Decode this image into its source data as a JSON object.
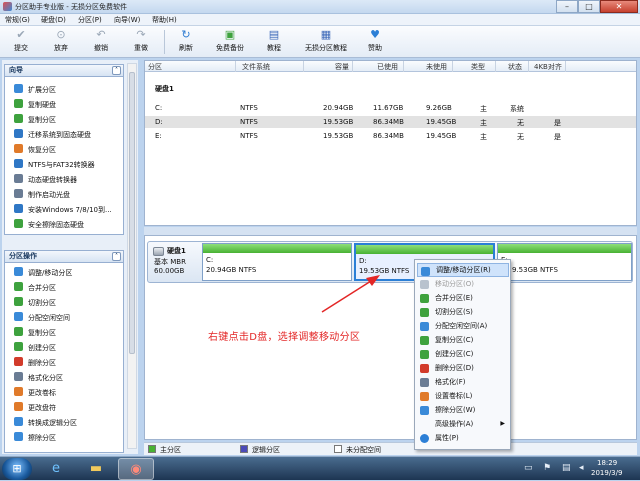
{
  "window": {
    "title": "分区助手专业版 - 无损分区免费软件",
    "minimize": "–",
    "maximize": "□",
    "close": "✕"
  },
  "menu": [
    "常规(G)",
    "硬盘(D)",
    "分区(P)",
    "向导(W)",
    "帮助(H)"
  ],
  "toolbar": [
    {
      "label": "提交",
      "icon": "✔",
      "color": "#9aa7b6"
    },
    {
      "label": "放弃",
      "icon": "⊙",
      "color": "#9aa7b6"
    },
    {
      "label": "撤销",
      "icon": "↶",
      "color": "#9aa7b6"
    },
    {
      "label": "重做",
      "icon": "↷",
      "color": "#9aa7b6"
    },
    {
      "label": "刷新",
      "icon": "↻",
      "color": "#2e7bd1"
    },
    {
      "label": "免费备份",
      "icon": "▣",
      "color": "#3ea23e"
    },
    {
      "label": "教程",
      "icon": "▤",
      "color": "#3a67b8"
    },
    {
      "label": "无损分区教程",
      "icon": "▦",
      "color": "#3a67b8"
    },
    {
      "label": "赞助",
      "icon": "♥",
      "color": "#2c7fd6"
    }
  ],
  "wizard": {
    "title": "向导",
    "items": [
      {
        "label": "扩展分区",
        "color": "#3a8ad8"
      },
      {
        "label": "复制硬盘",
        "color": "#3ea23e"
      },
      {
        "label": "复制分区",
        "color": "#3ea23e"
      },
      {
        "label": "迁移系统到固态硬盘",
        "color": "#2f77c5"
      },
      {
        "label": "恢复分区",
        "color": "#e07a2a"
      },
      {
        "label": "NTFS与FAT32转换器",
        "color": "#2f77c5"
      },
      {
        "label": "动态硬盘转换器",
        "color": "#6a7c94"
      },
      {
        "label": "制作启动光盘",
        "color": "#6a7c94"
      },
      {
        "label": "安装Windows 7/8/10到...",
        "color": "#2f77c5"
      },
      {
        "label": "安全擦除固态硬盘",
        "color": "#3ea23e"
      }
    ]
  },
  "ops": {
    "title": "分区操作",
    "items": [
      {
        "label": "调整/移动分区",
        "color": "#3a8ad8"
      },
      {
        "label": "合并分区",
        "color": "#3ea23e"
      },
      {
        "label": "切割分区",
        "color": "#3ea23e"
      },
      {
        "label": "分配空闲空间",
        "color": "#3a8ad8"
      },
      {
        "label": "复制分区",
        "color": "#3ea23e"
      },
      {
        "label": "创建分区",
        "color": "#3ea23e"
      },
      {
        "label": "删除分区",
        "color": "#d23b2b"
      },
      {
        "label": "格式化分区",
        "color": "#6a7c94"
      },
      {
        "label": "更改卷标",
        "color": "#e07a2a"
      },
      {
        "label": "更改盘符",
        "color": "#e07a2a"
      },
      {
        "label": "转换成逻辑分区",
        "color": "#3a8ad8"
      },
      {
        "label": "擦除分区",
        "color": "#3a8ad8"
      }
    ]
  },
  "table": {
    "headers": [
      "分区",
      "文件系统",
      "容量",
      "已使用",
      "未使用",
      "类型",
      "状态",
      "4KB对齐"
    ],
    "disk_label": "硬盘1",
    "rows": [
      {
        "part": "C:",
        "fs": "NTFS",
        "cap": "20.94GB",
        "used": "11.67GB",
        "free": "9.26GB",
        "type": "主",
        "status": "系统",
        "align": ""
      },
      {
        "part": "D:",
        "fs": "NTFS",
        "cap": "19.53GB",
        "used": "86.34MB",
        "free": "19.45GB",
        "type": "主",
        "status": "无",
        "align": "是"
      },
      {
        "part": "E:",
        "fs": "NTFS",
        "cap": "19.53GB",
        "used": "86.34MB",
        "free": "19.45GB",
        "type": "主",
        "status": "无",
        "align": "是"
      }
    ]
  },
  "disk_map": {
    "name": "硬盘1",
    "type": "基本 MBR",
    "size": "60.00GB",
    "partitions": [
      {
        "name": "C:",
        "info": "20.94GB NTFS"
      },
      {
        "name": "D:",
        "info": "19.53GB NTFS"
      },
      {
        "name": "E:",
        "info": "9.53GB NTFS"
      }
    ]
  },
  "context_menu": [
    {
      "label": "调整/移动分区(R)",
      "color": "#3a8ad8"
    },
    {
      "label": "移动分区(O)",
      "color": "#9aa7b6"
    },
    {
      "label": "合并分区(E)",
      "color": "#3ea23e"
    },
    {
      "label": "切割分区(S)",
      "color": "#3ea23e"
    },
    {
      "label": "分配空闲空间(A)",
      "color": "#3a8ad8"
    },
    {
      "label": "复制分区(C)",
      "color": "#3ea23e"
    },
    {
      "label": "创建分区(C)",
      "color": "#3ea23e"
    },
    {
      "label": "删除分区(D)",
      "color": "#d23b2b"
    },
    {
      "label": "格式化(F)",
      "color": "#6a7c94"
    },
    {
      "label": "设置卷标(L)",
      "color": "#e07a2a"
    },
    {
      "label": "擦除分区(W)",
      "color": "#3a8ad8"
    },
    {
      "label": "高级操作(A)",
      "arrow": "▶"
    },
    {
      "label": "属性(P)",
      "color": "#2c7fd6"
    }
  ],
  "annotation": "右键点击D盘，选择调整移动分区",
  "legend": {
    "primary": "主分区",
    "logical": "逻辑分区",
    "free": "未分配空间",
    "primary_color": "#48b233",
    "logical_color": "#4a4ab8",
    "free_color": "#ffffff"
  },
  "taskbar": {
    "time": "18:29",
    "date": "2019/3/9"
  }
}
